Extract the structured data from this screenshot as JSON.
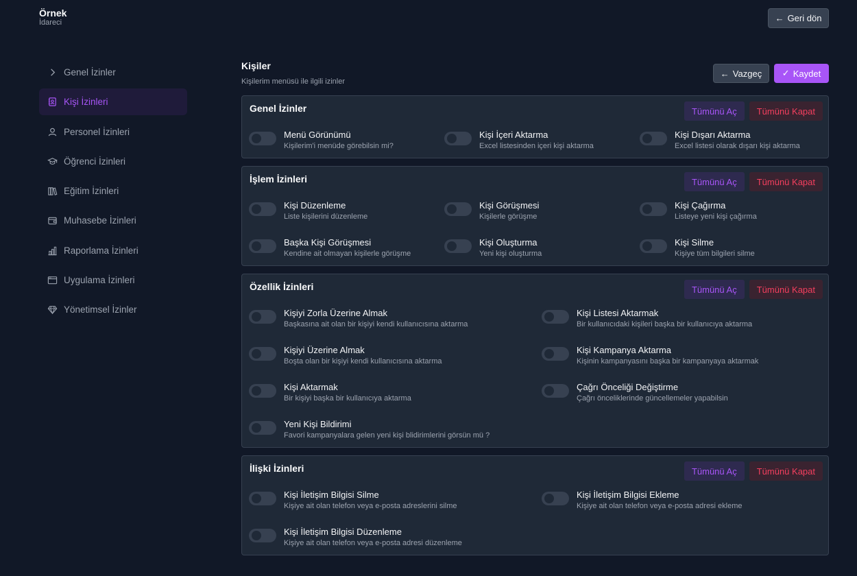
{
  "brand": {
    "title": "Örnek",
    "subtitle": "İdareci"
  },
  "top": {
    "back_label": "Geri dön"
  },
  "sidebar": {
    "items": [
      {
        "label": "Genel İzinler",
        "icon": "chevron-right-icon",
        "active": false
      },
      {
        "label": "Kişi İzinleri",
        "icon": "contact-book-icon",
        "active": true
      },
      {
        "label": "Personel İzinleri",
        "icon": "user-icon",
        "active": false
      },
      {
        "label": "Öğrenci İzinleri",
        "icon": "graduation-cap-icon",
        "active": false
      },
      {
        "label": "Eğitim İzinleri",
        "icon": "books-icon",
        "active": false
      },
      {
        "label": "Muhasebe İzinleri",
        "icon": "wallet-icon",
        "active": false
      },
      {
        "label": "Raporlama İzinleri",
        "icon": "bar-chart-icon",
        "active": false
      },
      {
        "label": "Uygulama İzinleri",
        "icon": "app-window-icon",
        "active": false
      },
      {
        "label": "Yönetimsel İzinler",
        "icon": "diamond-icon",
        "active": false
      }
    ]
  },
  "header": {
    "title": "Kişiler",
    "subtitle": "Kişilerim menüsü ile ilgili izinler",
    "cancel_label": "Vazgeç",
    "save_label": "Kaydet"
  },
  "section_buttons": {
    "on": "Tümünü Aç",
    "off": "Tümünü Kapat"
  },
  "sections": [
    {
      "title": "Genel İzinler",
      "perms": [
        {
          "label": "Menü Görünümü",
          "desc": "Kişilerim'i menüde görebilsin mi?"
        },
        {
          "label": "Kişi İçeri Aktarma",
          "desc": "Excel listesinden içeri kişi aktarma"
        },
        {
          "label": "Kişi Dışarı Aktarma",
          "desc": "Excel listesi olarak dışarı kişi aktarma"
        }
      ]
    },
    {
      "title": "İşlem İzinleri",
      "perms": [
        {
          "label": "Kişi Düzenleme",
          "desc": "Liste kişilerini düzenleme"
        },
        {
          "label": "Kişi Görüşmesi",
          "desc": "Kişilerle görüşme"
        },
        {
          "label": "Kişi Çağırma",
          "desc": "Listeye yeni kişi çağırma"
        },
        {
          "label": "Başka Kişi Görüşmesi",
          "desc": "Kendine ait olmayan kişilerle görüşme"
        },
        {
          "label": "Kişi Oluşturma",
          "desc": "Yeni kişi oluşturma"
        },
        {
          "label": "Kişi Silme",
          "desc": "Kişiye tüm bilgileri silme"
        }
      ]
    },
    {
      "title": "Özellik İzinleri",
      "perms": [
        {
          "label": "Kişiyi Zorla Üzerine Almak",
          "desc": "Başkasına ait olan bir kişiyi kendi kullanıcısına aktarma"
        },
        {
          "label": "Kişi Listesi Aktarmak",
          "desc": "Bir kullanıcıdaki kişileri başka bir kullanıcıya aktarma"
        },
        {
          "label": "Kişiyi Üzerine Almak",
          "desc": "Boşta olan bir kişiyi kendi kullanıcısına aktarma"
        },
        {
          "label": "Kişi Kampanya Aktarma",
          "desc": "Kişinin kampanyasını başka bir kampanyaya aktarmak"
        },
        {
          "label": "Kişi Aktarmak",
          "desc": "Bir kişiyi başka bir kullanıcıya aktarma"
        },
        {
          "label": "Çağrı Önceliği Değiştirme",
          "desc": "Çağrı önceliklerinde güncellemeler yapabilsin"
        },
        {
          "label": "Yeni Kişi Bildirimi",
          "desc": "Favori kampanyalara gelen yeni kişi blidirimlerini görsün mü ?"
        }
      ]
    },
    {
      "title": "İlişki İzinleri",
      "perms": [
        {
          "label": "Kişi İletişim Bilgisi Silme",
          "desc": "Kişiye ait olan telefon veya e-posta adreslerini silme"
        },
        {
          "label": "Kişi İletişim Bilgisi Ekleme",
          "desc": "Kişiye ait olan telefon veya e-posta adresi ekleme"
        },
        {
          "label": "Kişi İletişim Bilgisi Düzenleme",
          "desc": "Kişiye ait olan telefon veya e-posta adresi düzenleme"
        }
      ]
    }
  ],
  "colors": {
    "accent": "#a855f7",
    "danger": "#f43f5e",
    "bg": "#111827",
    "panel": "#1f2937"
  }
}
